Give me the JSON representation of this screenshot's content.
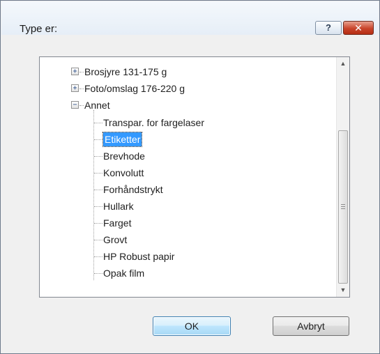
{
  "window": {
    "title": "Type er:",
    "help_label": "?",
    "close_label": "✕"
  },
  "tree": {
    "groups": [
      {
        "label": "Brosjyre 131-175 g",
        "expander": "+"
      },
      {
        "label": "Foto/omslag 176-220 g",
        "expander": "+"
      },
      {
        "label": "Annet",
        "expander": "−"
      }
    ],
    "children": [
      {
        "label": "Transpar. for fargelaser",
        "selected": false
      },
      {
        "label": "Etiketter",
        "selected": true
      },
      {
        "label": "Brevhode",
        "selected": false
      },
      {
        "label": "Konvolutt",
        "selected": false
      },
      {
        "label": "Forhåndstrykt",
        "selected": false
      },
      {
        "label": "Hullark",
        "selected": false
      },
      {
        "label": "Farget",
        "selected": false
      },
      {
        "label": "Grovt",
        "selected": false
      },
      {
        "label": "HP Robust papir",
        "selected": false
      },
      {
        "label": "Opak film",
        "selected": false
      }
    ]
  },
  "scrollbar": {
    "up_icon": "▲",
    "down_icon": "▼"
  },
  "buttons": {
    "ok": "OK",
    "cancel": "Avbryt"
  },
  "colors": {
    "selection": "#3399ff",
    "ok_border": "#3c7fb1",
    "close_red": "#c9452b"
  }
}
